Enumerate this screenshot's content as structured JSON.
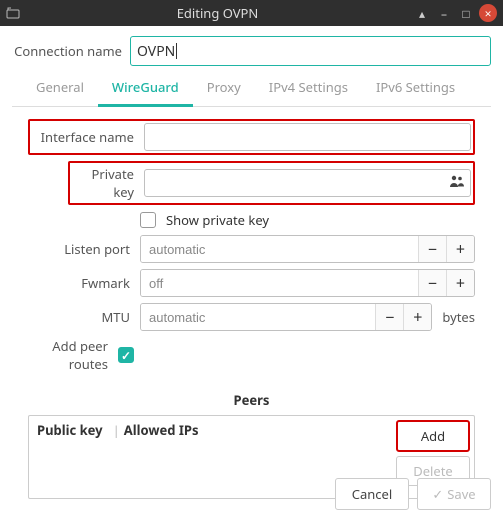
{
  "window": {
    "title": "Editing OVPN"
  },
  "connection_name": {
    "label": "Connection name",
    "value": "OVPN"
  },
  "tabs": [
    {
      "id": "general",
      "label": "General",
      "active": false
    },
    {
      "id": "wireguard",
      "label": "WireGuard",
      "active": true
    },
    {
      "id": "proxy",
      "label": "Proxy",
      "active": false
    },
    {
      "id": "ipv4",
      "label": "IPv4 Settings",
      "active": false
    },
    {
      "id": "ipv6",
      "label": "IPv6 Settings",
      "active": false
    }
  ],
  "wireguard": {
    "interface_name": {
      "label": "Interface name",
      "value": ""
    },
    "private_key": {
      "label": "Private key",
      "value": ""
    },
    "show_private_key": {
      "label": "Show private key",
      "checked": false
    },
    "listen_port": {
      "label": "Listen port",
      "value": "automatic"
    },
    "fwmark": {
      "label": "Fwmark",
      "value": "off"
    },
    "mtu": {
      "label": "MTU",
      "value": "automatic",
      "suffix": "bytes"
    },
    "add_peer_routes": {
      "label": "Add peer routes",
      "checked": true
    }
  },
  "peers": {
    "title": "Peers",
    "columns": [
      "Public key",
      "Allowed IPs"
    ],
    "rows": [],
    "buttons": {
      "add": "Add",
      "delete": "Delete"
    }
  },
  "footer": {
    "cancel": "Cancel",
    "save": "Save"
  }
}
